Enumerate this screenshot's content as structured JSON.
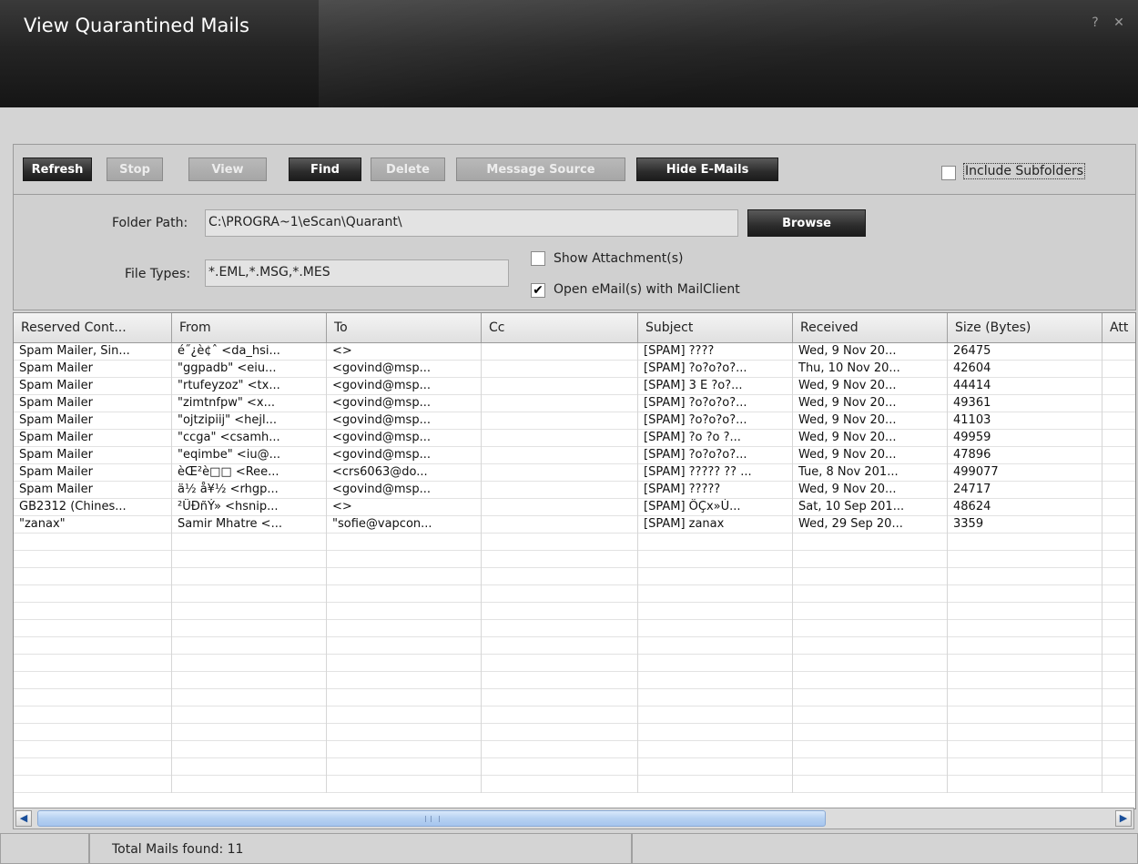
{
  "window": {
    "title": "View Quarantined Mails",
    "help_label": "?",
    "close_label": "✕"
  },
  "toolbar": {
    "buttons": [
      {
        "label": "Refresh",
        "enabled": true
      },
      {
        "label": "Stop",
        "enabled": false
      },
      {
        "label": "View",
        "enabled": false
      },
      {
        "label": "Find",
        "enabled": true
      },
      {
        "label": "Delete",
        "enabled": false
      },
      {
        "label": "Message Source",
        "enabled": false
      },
      {
        "label": "Hide E-Mails",
        "enabled": true
      }
    ],
    "include_subfolders": {
      "label": "Include Subfolders",
      "checked": false
    }
  },
  "paths": {
    "folder_label": "Folder Path:",
    "folder_value": "C:\\PROGRA~1\\eScan\\Quarant\\",
    "browse_label": "Browse",
    "file_types_label": "File Types:",
    "file_types_value": "*.EML,*.MSG,*.MES",
    "show_attachments": {
      "label": "Show Attachment(s)",
      "checked": false
    },
    "open_mailclient": {
      "label": "Open eMail(s) with MailClient",
      "checked": true
    }
  },
  "grid": {
    "columns": [
      "Reserved Cont...",
      "From",
      "To",
      "Cc",
      "Subject",
      "Received",
      "Size (Bytes)",
      "Att"
    ],
    "rows": [
      [
        "Spam Mailer, Sin...",
        "é˝¿è¢ˆ <da_hsi...",
        "<>",
        "",
        "[SPAM] ????",
        "Wed, 9 Nov 20...",
        "26475",
        ""
      ],
      [
        "Spam Mailer",
        "\"ggpadb\" <eiu...",
        "<govind@msp...",
        "",
        "[SPAM] ?o?o?o?...",
        "Thu, 10 Nov 20...",
        "42604",
        ""
      ],
      [
        "Spam Mailer",
        "\"rtufeyzoz\" <tx...",
        "<govind@msp...",
        "",
        "[SPAM] 3 E ?o?...",
        "Wed, 9 Nov 20...",
        "44414",
        ""
      ],
      [
        "Spam Mailer",
        "\"zimtnfpw\" <x...",
        "<govind@msp...",
        "",
        "[SPAM] ?o?o?o?...",
        "Wed, 9 Nov 20...",
        "49361",
        ""
      ],
      [
        "Spam Mailer",
        "\"ojtzipiij\" <hejl...",
        "<govind@msp...",
        "",
        "[SPAM] ?o?o?o?...",
        "Wed, 9 Nov 20...",
        "41103",
        ""
      ],
      [
        "Spam Mailer",
        "\"ccga\" <csamh...",
        "<govind@msp...",
        "",
        "[SPAM] ?o ?o ?...",
        "Wed, 9 Nov 20...",
        "49959",
        ""
      ],
      [
        "Spam Mailer",
        "\"eqimbe\" <iu@...",
        "<govind@msp...",
        "",
        "[SPAM] ?o?o?o?...",
        "Wed, 9 Nov 20...",
        "47896",
        ""
      ],
      [
        "Spam Mailer",
        "èŒ²è□□ <Ree...",
        "<crs6063@do...",
        "",
        "[SPAM] ????? ?? ...",
        "Tue, 8 Nov 201...",
        "499077",
        ""
      ],
      [
        "Spam Mailer",
        "ä½ å¥½ <rhgp...",
        "<govind@msp...",
        "",
        "[SPAM] ?????",
        "Wed, 9 Nov 20...",
        "24717",
        ""
      ],
      [
        "GB2312 (Chines...",
        "²ÜÐñÝ» <hsnip...",
        "<>",
        "",
        "[SPAM] ÖÇx»Ú...",
        "Sat, 10 Sep 201...",
        "48624",
        ""
      ],
      [
        "\"zanax\"",
        "Samir Mhatre <...",
        "\"sofie@vapcon...",
        "",
        "[SPAM] zanax",
        "Wed, 29 Sep 20...",
        "3359",
        ""
      ]
    ]
  },
  "status": {
    "total_text": "Total Mails found: 11"
  }
}
